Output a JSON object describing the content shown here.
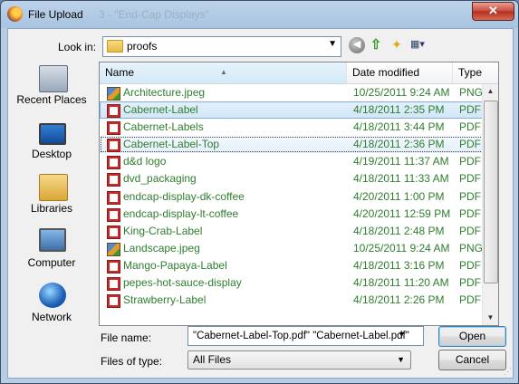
{
  "window": {
    "title": "File Upload",
    "background_title": "3 - \"End-Cap Displays\"",
    "close_glyph": "✕"
  },
  "toolbar": {
    "lookin_label": "Look in:",
    "lookin_value": "proofs",
    "back_icon": "back-arrow-icon",
    "up_icon": "up-folder-icon",
    "newfolder_icon": "new-folder-icon",
    "view_icon": "views-menu-icon"
  },
  "places": [
    {
      "label": "Recent Places",
      "icon": "recent-places-icon"
    },
    {
      "label": "Desktop",
      "icon": "desktop-icon"
    },
    {
      "label": "Libraries",
      "icon": "libraries-icon"
    },
    {
      "label": "Computer",
      "icon": "computer-icon"
    },
    {
      "label": "Network",
      "icon": "network-icon"
    }
  ],
  "columns": {
    "name": "Name",
    "date": "Date modified",
    "type": "Type"
  },
  "files": [
    {
      "name": "Architecture.jpeg",
      "date": "10/25/2011 9:24 AM",
      "type": "PNG in",
      "kind": "png",
      "state": ""
    },
    {
      "name": "Cabernet-Label",
      "date": "4/18/2011 2:35 PM",
      "type": "PDF Fil",
      "kind": "pdf",
      "state": "sel"
    },
    {
      "name": "Cabernet-Labels",
      "date": "4/18/2011 3:44 PM",
      "type": "PDF Fil",
      "kind": "pdf",
      "state": ""
    },
    {
      "name": "Cabernet-Label-Top",
      "date": "4/18/2011 2:36 PM",
      "type": "PDF Fil",
      "kind": "pdf",
      "state": "focus"
    },
    {
      "name": "d&d logo",
      "date": "4/19/2011 11:37 AM",
      "type": "PDF Fil",
      "kind": "pdf",
      "state": ""
    },
    {
      "name": "dvd_packaging",
      "date": "4/18/2011 11:33 AM",
      "type": "PDF Fil",
      "kind": "pdf",
      "state": ""
    },
    {
      "name": "endcap-display-dk-coffee",
      "date": "4/20/2011 1:00 PM",
      "type": "PDF Fil",
      "kind": "pdf",
      "state": ""
    },
    {
      "name": "endcap-display-lt-coffee",
      "date": "4/20/2011 12:59 PM",
      "type": "PDF Fil",
      "kind": "pdf",
      "state": ""
    },
    {
      "name": "King-Crab-Label",
      "date": "4/18/2011 2:48 PM",
      "type": "PDF Fil",
      "kind": "pdf",
      "state": ""
    },
    {
      "name": "Landscape.jpeg",
      "date": "10/25/2011 9:24 AM",
      "type": "PNG in",
      "kind": "png",
      "state": ""
    },
    {
      "name": "Mango-Papaya-Label",
      "date": "4/18/2011 3:16 PM",
      "type": "PDF Fil",
      "kind": "pdf",
      "state": ""
    },
    {
      "name": "pepes-hot-sauce-display",
      "date": "4/18/2011 11:20 AM",
      "type": "PDF Fil",
      "kind": "pdf",
      "state": ""
    },
    {
      "name": "Strawberry-Label",
      "date": "4/18/2011 2:26 PM",
      "type": "PDF Fil",
      "kind": "pdf",
      "state": ""
    }
  ],
  "filename": {
    "label": "File name:",
    "value": "\"Cabernet-Label-Top.pdf\" \"Cabernet-Label.pdf\""
  },
  "filetype": {
    "label": "Files of type:",
    "value": "All Files"
  },
  "buttons": {
    "open": "Open",
    "cancel": "Cancel"
  }
}
